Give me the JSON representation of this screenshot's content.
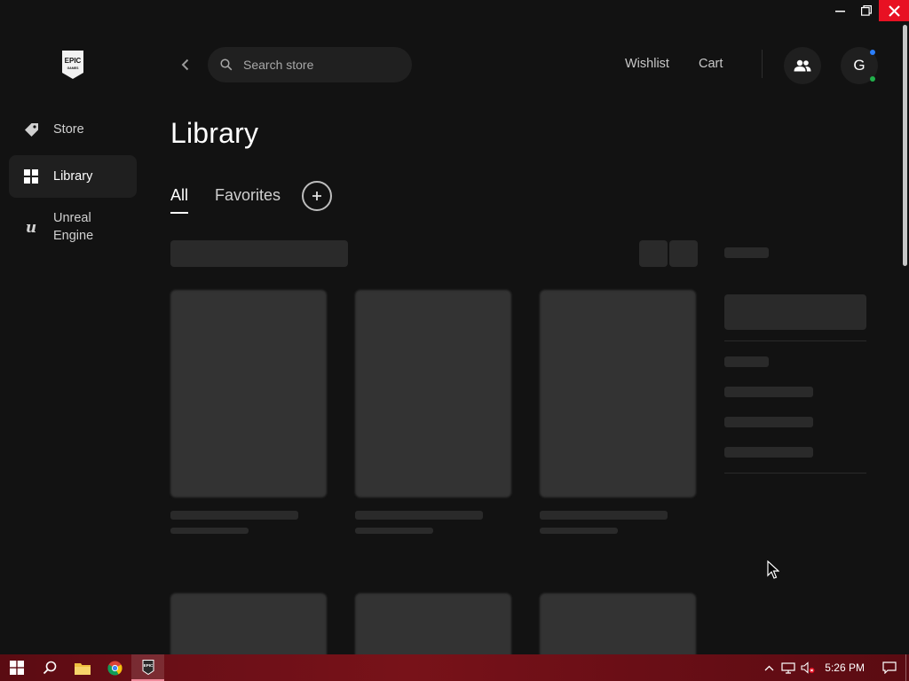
{
  "window": {
    "controls": {
      "minimize_icon": "minimize-icon",
      "restore_icon": "restore-icon",
      "close_icon": "close-icon",
      "close_color": "#e81123"
    }
  },
  "sidebar": {
    "logo": {
      "line1": "EPIC",
      "line2": "GAMES"
    },
    "items": [
      {
        "label": "Store",
        "icon": "tag-icon",
        "active": false
      },
      {
        "label": "Library",
        "icon": "grid-icon",
        "active": true
      },
      {
        "label": "Unreal\nEngine",
        "icon": "unreal-engine-icon",
        "active": false
      }
    ]
  },
  "header": {
    "search_placeholder": "Search store",
    "wishlist": "Wishlist",
    "cart": "Cart",
    "avatar_initial": "G",
    "status_colors": {
      "online": "#21b04b",
      "notification": "#2a7fff"
    }
  },
  "main": {
    "title": "Library",
    "tabs": [
      {
        "label": "All",
        "active": true
      },
      {
        "label": "Favorites",
        "active": false
      }
    ],
    "add_collection_icon": "plus-icon"
  },
  "taskbar": {
    "time": "5:26 PM",
    "apps": [
      "windows-start-icon",
      "search-icon",
      "file-explorer-icon",
      "chrome-icon",
      "epic-games-icon"
    ],
    "tray": [
      "chevron-up-icon",
      "network-icon",
      "volume-muted-icon",
      "notifications-icon"
    ]
  },
  "colors": {
    "background": "#121212",
    "sidebar_active": "#1f1f1f",
    "skeleton": "#2a2a2a",
    "taskbar": "#6b0f17"
  }
}
